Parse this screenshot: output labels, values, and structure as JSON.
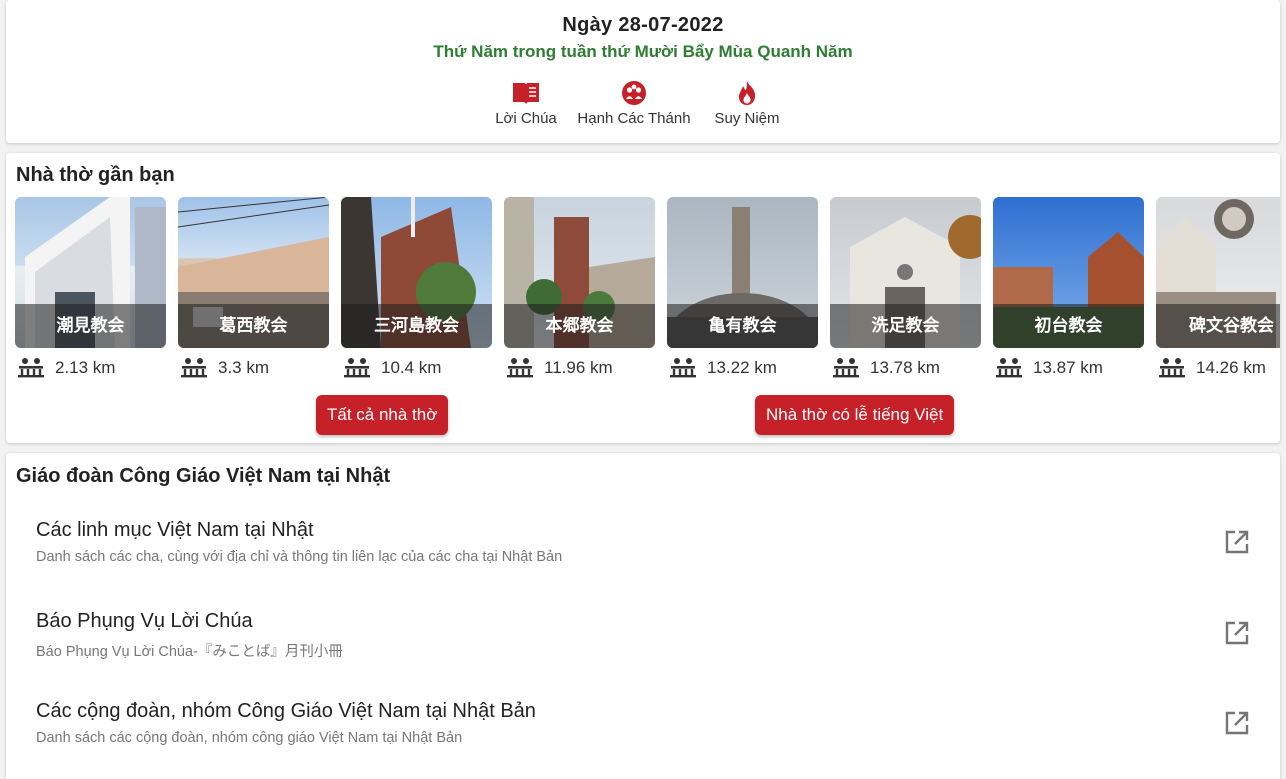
{
  "header": {
    "date": "Ngày 28-07-2022",
    "liturgical_day": "Thứ Năm trong tuần thứ Mười Bẩy Mùa Quanh Năm",
    "accent_color": "#2e7d32"
  },
  "quick_links": [
    {
      "label": "Lời Chúa",
      "icon": "book-icon"
    },
    {
      "label": "Hạnh Các Thánh",
      "icon": "saints-icon"
    },
    {
      "label": "Suy Niệm",
      "icon": "flame-icon"
    }
  ],
  "nearby": {
    "title": "Nhà thờ gần bạn",
    "churches": [
      {
        "name": "潮見教会",
        "distance": "2.13 km"
      },
      {
        "name": "葛西教会",
        "distance": "3.3 km"
      },
      {
        "name": "三河島教会",
        "distance": "10.4 km"
      },
      {
        "name": "本郷教会",
        "distance": "11.96 km"
      },
      {
        "name": "亀有教会",
        "distance": "13.22 km"
      },
      {
        "name": "洗足教会",
        "distance": "13.78 km"
      },
      {
        "name": "初台教会",
        "distance": "13.87 km"
      },
      {
        "name": "碑文谷教会",
        "distance": "14.26 km"
      }
    ],
    "all_button": "Tất cả nhà thờ",
    "vn_button": "Nhà thờ có lễ tiếng Việt",
    "button_color": "#c62028"
  },
  "community": {
    "title": "Giáo đoàn Công Giáo Việt Nam tại Nhật",
    "items": [
      {
        "title": "Các linh mục Việt Nam tại Nhật",
        "subtitle": "Danh sách các cha, cùng với địa chỉ và thông tin liên lạc của các cha tại Nhật Bản"
      },
      {
        "title": "Báo Phụng Vụ Lời Chúa",
        "subtitle": "Báo Phụng Vụ Lời Chúa-『みことば』月刊小冊"
      },
      {
        "title": "Các cộng đoàn, nhóm Công Giáo Việt Nam tại Nhật Bản",
        "subtitle": "Danh sách các cộng đoàn, nhóm công giáo Việt Nam tại Nhật Bản"
      }
    ]
  }
}
